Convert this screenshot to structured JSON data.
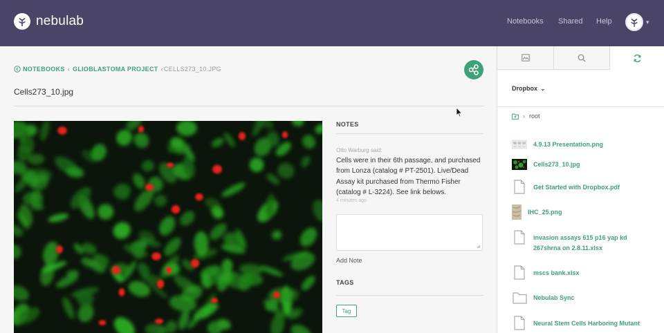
{
  "app": {
    "name": "Nebulab"
  },
  "header": {
    "brand": "nebulab",
    "nav": [
      "Notebooks",
      "Shared",
      "Help"
    ]
  },
  "breadcrumb": {
    "notebooks": "NOTEBOOKS",
    "project": "GLIOBLASTOMA PROJECT",
    "current": "CELLS273_10.JPG"
  },
  "page": {
    "title": "Cells273_10.jpg"
  },
  "notes": {
    "heading": "NOTES",
    "author": "Otto Warburg said:",
    "body": "Cells were in their 6th passage, and purchased from Lonza (catalog # PT-2501). Live/Dead Assay kit purchased from Thermo Fisher (catalog # L-3224). See link belows.",
    "time": "4 minutes ago",
    "add_label": "Add Note"
  },
  "tags": {
    "heading": "TAGS",
    "button": "Tag"
  },
  "sidebar": {
    "tabs": [
      {
        "icon": "image-icon"
      },
      {
        "icon": "search-icon"
      },
      {
        "icon": "sync-icon",
        "active": true
      }
    ],
    "source": "Dropbox",
    "root": "root",
    "files": [
      {
        "name": "4.9.13 Presentation.png",
        "icon": "thumbnail-slides"
      },
      {
        "name": "Cells273_10.jpg",
        "icon": "thumbnail-cells"
      },
      {
        "name": "Get Started with Dropbox.pdf",
        "icon": "document-icon"
      },
      {
        "name": "IHC_25.png",
        "icon": "thumbnail-tissue"
      },
      {
        "name": "invasion assays 615 p16 yap kd 267shrna on 2.8.11.xlsx",
        "icon": "document-icon"
      },
      {
        "name": "mscs bank.xlsx",
        "icon": "document-icon"
      },
      {
        "name": "Nebulab Sync",
        "icon": "folder-icon"
      },
      {
        "name": "Neural Stem Cells Harboring Mutant",
        "icon": "document-icon"
      }
    ]
  },
  "colors": {
    "header": "#4a4566",
    "accent": "#3fa17a"
  }
}
